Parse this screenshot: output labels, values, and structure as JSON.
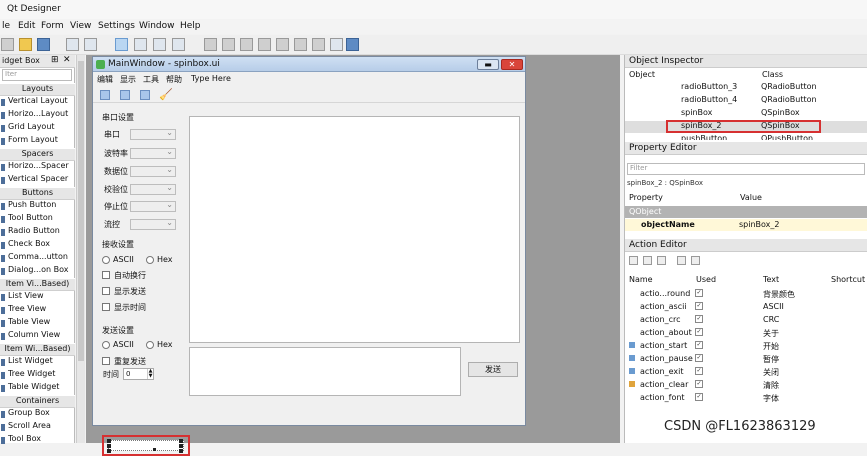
{
  "app": {
    "title": "Qt Designer"
  },
  "menubar": [
    "le",
    "Edit",
    "Form",
    "View",
    "Settings",
    "Window",
    "Help"
  ],
  "widget_box": {
    "title": "idget Box",
    "filter_placeholder": "Iter",
    "rows": [
      {
        "t": "Layouts",
        "cat": true
      },
      {
        "t": "Vertical Layout"
      },
      {
        "t": "Horizo...Layout"
      },
      {
        "t": "Grid Layout"
      },
      {
        "t": "Form Layout"
      },
      {
        "t": "Spacers",
        "cat": true
      },
      {
        "t": "Horizo...Spacer"
      },
      {
        "t": "Vertical Spacer"
      },
      {
        "t": "Buttons",
        "cat": true
      },
      {
        "t": "Push Button"
      },
      {
        "t": "Tool Button"
      },
      {
        "t": "Radio Button"
      },
      {
        "t": "Check Box"
      },
      {
        "t": "Comma...utton"
      },
      {
        "t": "Dialog...on Box"
      },
      {
        "t": "Item Vi...Based)",
        "cat": true
      },
      {
        "t": "List View"
      },
      {
        "t": "Tree View"
      },
      {
        "t": "Table View"
      },
      {
        "t": "Column View"
      },
      {
        "t": "Item Wi...Based)",
        "cat": true
      },
      {
        "t": "List Widget"
      },
      {
        "t": "Tree Widget"
      },
      {
        "t": "Table Widget"
      },
      {
        "t": "Containers",
        "cat": true
      },
      {
        "t": "Group Box"
      },
      {
        "t": "Scroll Area"
      },
      {
        "t": "Tool Box"
      }
    ]
  },
  "form": {
    "title": "MainWindow - spinbox.ui",
    "menu": [
      "编辑",
      "显示",
      "工具",
      "帮助",
      "Type Here"
    ],
    "serial_group": "串口设置",
    "serial_labels": [
      "串口",
      "波特率",
      "数据位",
      "校验位",
      "停止位",
      "流控"
    ],
    "recv_group": "接收设置",
    "recv_radios": [
      "ASCII",
      "Hex"
    ],
    "recv_checks": [
      "自动换行",
      "显示发送",
      "显示时间"
    ],
    "send_group": "发送设置",
    "send_radios": [
      "ASCII",
      "Hex"
    ],
    "send_checks": [
      "重复发送"
    ],
    "time_label": "时间",
    "time_value": "0",
    "send_button": "发送"
  },
  "object_inspector": {
    "title": "Object Inspector",
    "col_object": "Object",
    "col_class": "Class",
    "rows": [
      {
        "o": "radioButton_3",
        "c": "QRadioButton"
      },
      {
        "o": "radioButton_4",
        "c": "QRadioButton"
      },
      {
        "o": "spinBox",
        "c": "QSpinBox"
      },
      {
        "o": "spinBox_2",
        "c": "QSpinBox"
      },
      {
        "o": "pushButton",
        "c": "QPushButton"
      }
    ]
  },
  "property_editor": {
    "title": "Property Editor",
    "filter_placeholder": "Filter",
    "path": "spinBox_2 : QSpinBox",
    "col_property": "Property",
    "col_value": "Value",
    "section": "QObject",
    "prop_name": "objectName",
    "prop_value": "spinBox_2"
  },
  "action_editor": {
    "title": "Action Editor",
    "col_name": "Name",
    "col_used": "Used",
    "col_text": "Text",
    "col_shortcut": "Shortcut",
    "rows": [
      {
        "n": "actio...round",
        "t": "背景颜色",
        "icon": ""
      },
      {
        "n": "action_ascii",
        "t": "ASCII",
        "icon": ""
      },
      {
        "n": "action_crc",
        "t": "CRC",
        "icon": ""
      },
      {
        "n": "action_about",
        "t": "关于",
        "icon": ""
      },
      {
        "n": "action_start",
        "t": "开始",
        "icon": "#6a9bd0"
      },
      {
        "n": "action_pause",
        "t": "暂停",
        "icon": "#6a9bd0"
      },
      {
        "n": "action_exit",
        "t": "关闭",
        "icon": "#6a9bd0"
      },
      {
        "n": "action_clear",
        "t": "清除",
        "icon": "#e0a43c"
      },
      {
        "n": "action_font",
        "t": "字体",
        "icon": ""
      }
    ]
  },
  "watermark": "CSDN @FL1623863129",
  "colors": {
    "highlight": "#d63031"
  }
}
